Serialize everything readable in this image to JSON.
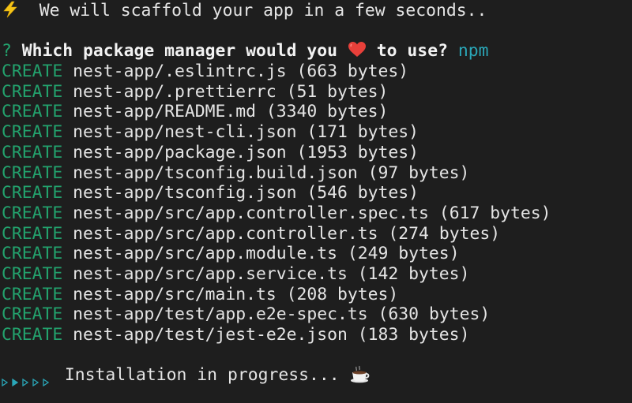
{
  "header": {
    "icon": "lightning-bolt-icon",
    "message": "  We will scaffold your app in a few seconds.."
  },
  "prompt": {
    "marker": "?",
    "question_before": "Which package manager would you",
    "question_icon": "heart-icon",
    "question_after": "to use?",
    "answer": "npm"
  },
  "files": [
    {
      "action": "CREATE",
      "path": "nest-app/.eslintrc.js",
      "size": "(663 bytes)"
    },
    {
      "action": "CREATE",
      "path": "nest-app/.prettierrc",
      "size": "(51 bytes)"
    },
    {
      "action": "CREATE",
      "path": "nest-app/README.md",
      "size": "(3340 bytes)"
    },
    {
      "action": "CREATE",
      "path": "nest-app/nest-cli.json",
      "size": "(171 bytes)"
    },
    {
      "action": "CREATE",
      "path": "nest-app/package.json",
      "size": "(1953 bytes)"
    },
    {
      "action": "CREATE",
      "path": "nest-app/tsconfig.build.json",
      "size": "(97 bytes)"
    },
    {
      "action": "CREATE",
      "path": "nest-app/tsconfig.json",
      "size": "(546 bytes)"
    },
    {
      "action": "CREATE",
      "path": "nest-app/src/app.controller.spec.ts",
      "size": "(617 bytes)"
    },
    {
      "action": "CREATE",
      "path": "nest-app/src/app.controller.ts",
      "size": "(274 bytes)"
    },
    {
      "action": "CREATE",
      "path": "nest-app/src/app.module.ts",
      "size": "(249 bytes)"
    },
    {
      "action": "CREATE",
      "path": "nest-app/src/app.service.ts",
      "size": "(142 bytes)"
    },
    {
      "action": "CREATE",
      "path": "nest-app/src/main.ts",
      "size": "(208 bytes)"
    },
    {
      "action": "CREATE",
      "path": "nest-app/test/app.e2e-spec.ts",
      "size": "(630 bytes)"
    },
    {
      "action": "CREATE",
      "path": "nest-app/test/jest-e2e.json",
      "size": "(183 bytes)"
    }
  ],
  "progress": {
    "spinner_frames": 5,
    "spinner_active_index": 1,
    "message": "Installation in progress...",
    "icon": "coffee-cup-icon"
  },
  "colors": {
    "background": "#1e1e1e",
    "text": "#e5e5e5",
    "create": "#23a26d",
    "answer": "#2aa7b8",
    "spinner": "#2aa7b8"
  }
}
